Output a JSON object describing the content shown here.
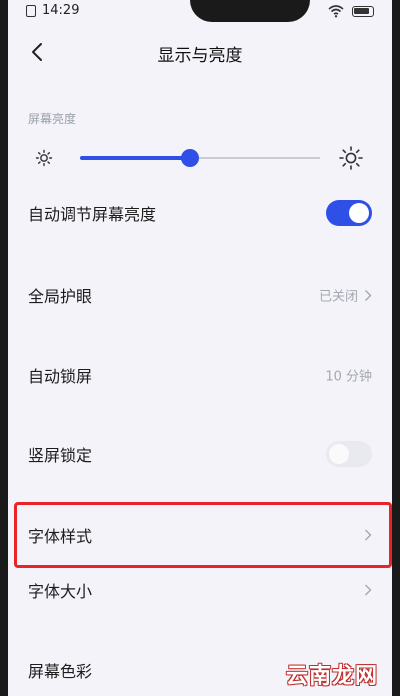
{
  "status_bar": {
    "time": "14:29"
  },
  "header": {
    "title": "显示与亮度"
  },
  "brightness": {
    "section_label": "屏幕亮度",
    "level_fraction": 0.46
  },
  "rows": {
    "auto_brightness": {
      "label": "自动调节屏幕亮度",
      "toggle": "on"
    },
    "eye_care": {
      "label": "全局护眼",
      "value": "已关闭"
    },
    "auto_lock": {
      "label": "自动锁屏",
      "value": "10 分钟"
    },
    "portrait_lock": {
      "label": "竖屏锁定",
      "toggle": "off"
    },
    "font_style": {
      "label": "字体样式"
    },
    "font_size": {
      "label": "字体大小"
    },
    "screen_color": {
      "label": "屏幕色彩"
    }
  },
  "watermark": "云南龙网",
  "colors": {
    "accent": "#2f50e6",
    "highlight": "#e8242a",
    "background": "#f3f3f9"
  },
  "icons": [
    "back-arrow-icon",
    "sun-small-icon",
    "sun-large-icon",
    "chevron-right-icon",
    "wifi-icon",
    "battery-icon",
    "sim-icon"
  ]
}
